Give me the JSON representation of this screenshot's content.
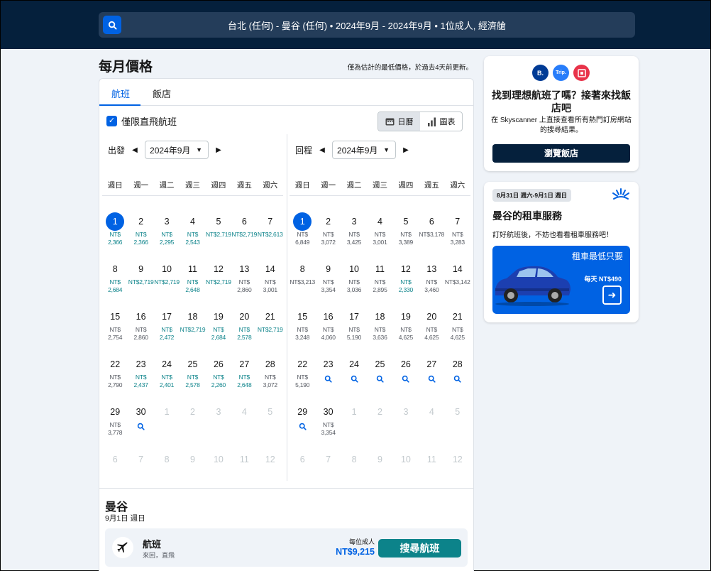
{
  "search": {
    "summary": "台北 (任何) - 曼谷 (任何)  •  2024年9月 - 2024年9月  •  1位成人, 經濟艙"
  },
  "header": {
    "title": "每月價格",
    "note": "僅為估計的最低價格，於過去4天前更新。"
  },
  "tabs": [
    {
      "label": "航班",
      "active": true
    },
    {
      "label": "飯店",
      "active": false
    }
  ],
  "filter": {
    "direct_only_label": "僅限直飛航班",
    "checked": true
  },
  "view_toggle": {
    "calendar_label": "日曆",
    "chart_label": "圖表",
    "active": "calendar"
  },
  "weekdays": [
    "週日",
    "週一",
    "週二",
    "週三",
    "週四",
    "週五",
    "週六"
  ],
  "outbound": {
    "label": "出發",
    "month": "2024年9月",
    "days": [
      {
        "d": "1",
        "p": "NT$ 2,366",
        "c": true,
        "sel": true
      },
      {
        "d": "2",
        "p": "NT$ 2,366",
        "c": true
      },
      {
        "d": "3",
        "p": "NT$ 2,295",
        "c": true
      },
      {
        "d": "4",
        "p": "NT$ 2,543",
        "c": true
      },
      {
        "d": "5",
        "p": "NT$2,719",
        "c": true
      },
      {
        "d": "6",
        "p": "NT$2,719",
        "c": true
      },
      {
        "d": "7",
        "p": "NT$2,613",
        "c": true
      },
      {
        "d": "8",
        "p": "NT$ 2,684",
        "c": true
      },
      {
        "d": "9",
        "p": "NT$2,719",
        "c": true
      },
      {
        "d": "10",
        "p": "NT$2,719",
        "c": true
      },
      {
        "d": "11",
        "p": "NT$ 2,648",
        "c": true
      },
      {
        "d": "12",
        "p": "NT$2,719",
        "c": true
      },
      {
        "d": "13",
        "p": "NT$ 2,860",
        "c": false
      },
      {
        "d": "14",
        "p": "NT$ 3,001",
        "c": false
      },
      {
        "d": "15",
        "p": "NT$ 2,754",
        "c": false
      },
      {
        "d": "16",
        "p": "NT$ 2,860",
        "c": false
      },
      {
        "d": "17",
        "p": "NT$ 2,472",
        "c": true
      },
      {
        "d": "18",
        "p": "NT$2,719",
        "c": true
      },
      {
        "d": "19",
        "p": "NT$ 2,684",
        "c": true
      },
      {
        "d": "20",
        "p": "NT$ 2,578",
        "c": true
      },
      {
        "d": "21",
        "p": "NT$2,719",
        "c": true
      },
      {
        "d": "22",
        "p": "NT$ 2,790",
        "c": false
      },
      {
        "d": "23",
        "p": "NT$ 2,437",
        "c": true
      },
      {
        "d": "24",
        "p": "NT$ 2,401",
        "c": true
      },
      {
        "d": "25",
        "p": "NT$ 2,578",
        "c": true
      },
      {
        "d": "26",
        "p": "NT$ 2,260",
        "c": true
      },
      {
        "d": "27",
        "p": "NT$ 2,648",
        "c": true
      },
      {
        "d": "28",
        "p": "NT$ 3,072",
        "c": false
      },
      {
        "d": "29",
        "p": "NT$ 3,778",
        "c": false
      },
      {
        "d": "30",
        "search": true
      },
      {
        "d": "1",
        "muted": true
      },
      {
        "d": "2",
        "muted": true
      },
      {
        "d": "3",
        "muted": true
      },
      {
        "d": "4",
        "muted": true
      },
      {
        "d": "5",
        "muted": true
      },
      {
        "d": "6",
        "muted": true
      },
      {
        "d": "7",
        "muted": true
      },
      {
        "d": "8",
        "muted": true
      },
      {
        "d": "9",
        "muted": true
      },
      {
        "d": "10",
        "muted": true
      },
      {
        "d": "11",
        "muted": true
      },
      {
        "d": "12",
        "muted": true
      }
    ]
  },
  "return": {
    "label": "回程",
    "month": "2024年9月",
    "days": [
      {
        "d": "1",
        "p": "NT$ 6,849",
        "c": false,
        "sel": true
      },
      {
        "d": "2",
        "p": "NT$ 3,072",
        "c": false
      },
      {
        "d": "3",
        "p": "NT$ 3,425",
        "c": false
      },
      {
        "d": "4",
        "p": "NT$ 3,001",
        "c": false
      },
      {
        "d": "5",
        "p": "NT$ 3,389",
        "c": false
      },
      {
        "d": "6",
        "p": "NT$3,178",
        "c": false
      },
      {
        "d": "7",
        "p": "NT$ 3,283",
        "c": false
      },
      {
        "d": "8",
        "p": "NT$3,213",
        "c": false
      },
      {
        "d": "9",
        "p": "NT$ 3,354",
        "c": false
      },
      {
        "d": "10",
        "p": "NT$ 3,036",
        "c": false
      },
      {
        "d": "11",
        "p": "NT$ 2,895",
        "c": false
      },
      {
        "d": "12",
        "p": "NT$ 2,330",
        "c": true
      },
      {
        "d": "13",
        "p": "NT$ 3,460",
        "c": false
      },
      {
        "d": "14",
        "p": "NT$3,142",
        "c": false
      },
      {
        "d": "15",
        "p": "NT$ 3,248",
        "c": false
      },
      {
        "d": "16",
        "p": "NT$ 4,060",
        "c": false
      },
      {
        "d": "17",
        "p": "NT$ 5,190",
        "c": false
      },
      {
        "d": "18",
        "p": "NT$ 3,636",
        "c": false
      },
      {
        "d": "19",
        "p": "NT$ 4,625",
        "c": false
      },
      {
        "d": "20",
        "p": "NT$ 4,625",
        "c": false
      },
      {
        "d": "21",
        "p": "NT$ 4,625",
        "c": false
      },
      {
        "d": "22",
        "p": "NT$ 5,190",
        "c": false
      },
      {
        "d": "23",
        "search": true
      },
      {
        "d": "24",
        "search": true
      },
      {
        "d": "25",
        "search": true
      },
      {
        "d": "26",
        "search": true
      },
      {
        "d": "27",
        "search": true
      },
      {
        "d": "28",
        "search": true
      },
      {
        "d": "29",
        "search": true
      },
      {
        "d": "30",
        "p": "NT$ 3,354",
        "c": false
      },
      {
        "d": "1",
        "muted": true
      },
      {
        "d": "2",
        "muted": true
      },
      {
        "d": "3",
        "muted": true
      },
      {
        "d": "4",
        "muted": true
      },
      {
        "d": "5",
        "muted": true
      },
      {
        "d": "6",
        "muted": true
      },
      {
        "d": "7",
        "muted": true
      },
      {
        "d": "8",
        "muted": true
      },
      {
        "d": "9",
        "muted": true
      },
      {
        "d": "10",
        "muted": true
      },
      {
        "d": "11",
        "muted": true
      },
      {
        "d": "12",
        "muted": true
      }
    ]
  },
  "result": {
    "destination": "曼谷",
    "date": "9月1日 週日",
    "flight_title": "航班",
    "flight_sub": "來回，直飛",
    "per_adult": "每位成人",
    "price": "NT$9,215",
    "button": "搜尋航班"
  },
  "hotel_promo": {
    "logos": [
      {
        "name": "booking-logo",
        "text": "B.",
        "color": "#003b95"
      },
      {
        "name": "trip-logo",
        "text": "Trip.",
        "color": "#287dfa"
      },
      {
        "name": "agoda-logo",
        "text": "",
        "color": "#e8334a"
      }
    ],
    "title": "找到理想航班了嗎？接著來找飯店吧",
    "desc": "在 Skyscanner 上直接查看所有熱門訂房網站的搜尋結果。",
    "button": "瀏覽飯店"
  },
  "car_promo": {
    "dates": "8月31日 週六-9月1日 週日",
    "title": "曼谷的租車服務",
    "desc": "訂好航班後，不妨也看看租車服務吧！",
    "headline": "租車最低只要",
    "per_day": "每天 NT$490"
  },
  "colors": {
    "accent": "#0062e3",
    "cheap": "#0c838a",
    "navy": "#05203c"
  }
}
